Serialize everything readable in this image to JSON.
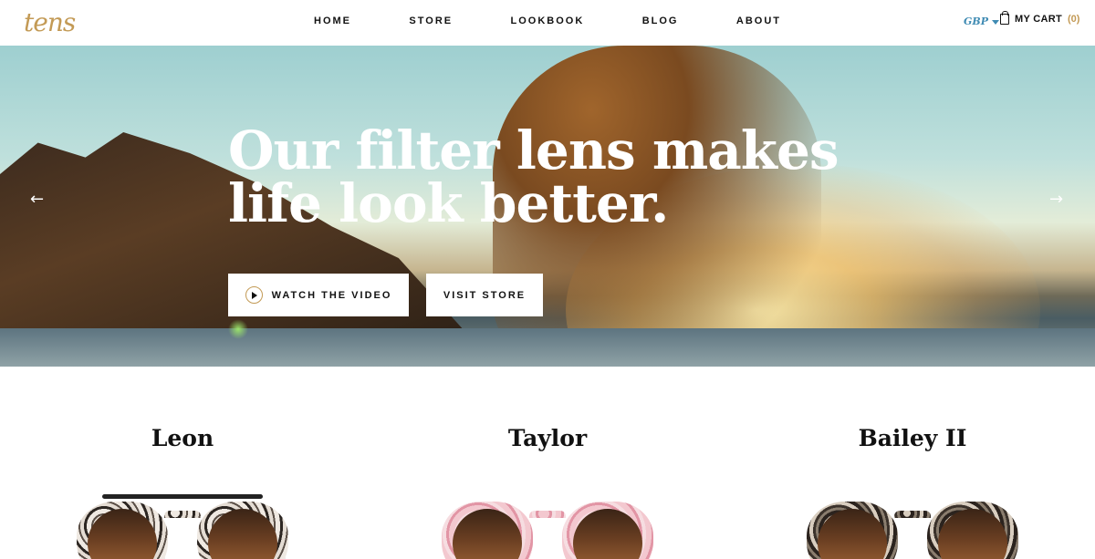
{
  "header": {
    "logo": "tens",
    "nav": [
      "HOME",
      "STORE",
      "LOOKBOOK",
      "BLOG",
      "ABOUT"
    ],
    "currency": "GBP",
    "cart_label": "MY CART",
    "cart_count": "(0)"
  },
  "hero": {
    "headline": "Our filter lens makes life look better.",
    "watch_label": "WATCH THE VIDEO",
    "store_label": "VISIT STORE",
    "prev_icon": "arrow-left-icon",
    "next_icon": "arrow-right-icon"
  },
  "products": [
    {
      "name": "Leon",
      "frame": "tortoise"
    },
    {
      "name": "Taylor",
      "frame": "pink"
    },
    {
      "name": "Bailey II",
      "frame": "dark-tortoise"
    }
  ],
  "colors": {
    "brand_gold": "#c39a55",
    "currency_blue": "#3f8bb3",
    "text": "#111111",
    "background": "#ffffff"
  }
}
